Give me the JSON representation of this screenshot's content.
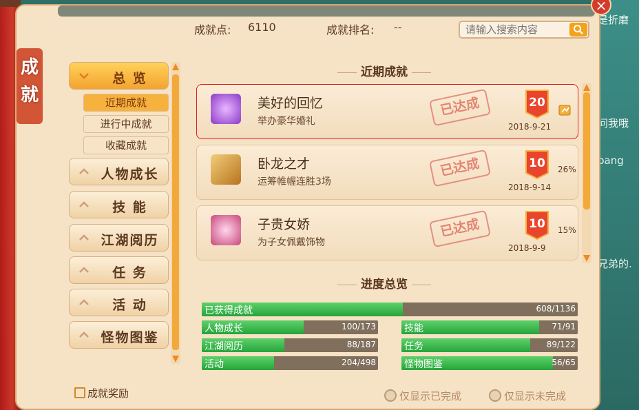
{
  "background": {
    "right_lines": [
      "是折磨",
      "问我哦",
      "bang",
      "兄弟的."
    ]
  },
  "window": {
    "side_title_1": "成",
    "side_title_2": "就"
  },
  "header": {
    "points_label": "成就点:",
    "points_value": "6110",
    "rank_label": "成就排名:",
    "rank_value": "--"
  },
  "search": {
    "placeholder": "请输入搜索内容"
  },
  "nav": {
    "overview": "总 览",
    "sub_items": [
      "近期成就",
      "进行中成就",
      "收藏成就"
    ],
    "categories": [
      "人物成长",
      "技 能",
      "江湖阅历",
      "任 务",
      "活 动",
      "怪物图鉴"
    ]
  },
  "reward_label": "成就奖励",
  "recent": {
    "title": "近期成就",
    "items": [
      {
        "name": "美好的回忆",
        "desc": "举办豪华婚礼",
        "stamp": "已达成",
        "points": "20",
        "date": "2018-9-21",
        "pct": ""
      },
      {
        "name": "卧龙之才",
        "desc": "运筹帷幄连胜3场",
        "stamp": "已达成",
        "points": "10",
        "date": "2018-9-14",
        "pct": "26%"
      },
      {
        "name": "子贵女娇",
        "desc": "为子女佩戴饰物",
        "stamp": "已达成",
        "points": "10",
        "date": "2018-9-9",
        "pct": "15%"
      }
    ]
  },
  "progress": {
    "title": "进度总览",
    "total": {
      "label": "已获得成就",
      "value": "608/1136",
      "fraction": 0.535
    },
    "categories": [
      {
        "label": "人物成长",
        "value": "100/173",
        "fraction": 0.578
      },
      {
        "label": "技能",
        "value": "71/91",
        "fraction": 0.78
      },
      {
        "label": "江湖阅历",
        "value": "88/187",
        "fraction": 0.47
      },
      {
        "label": "任务",
        "value": "89/122",
        "fraction": 0.73
      },
      {
        "label": "活动",
        "value": "204/498",
        "fraction": 0.41
      },
      {
        "label": "怪物图鉴",
        "value": "56/65",
        "fraction": 0.86
      }
    ]
  },
  "filters": {
    "completed": "仅显示已完成",
    "incomplete": "仅显示未完成"
  },
  "colors": {
    "accent": "#f3a430",
    "progress_fill": "#2fb244",
    "panel": "#f6e2c4"
  }
}
